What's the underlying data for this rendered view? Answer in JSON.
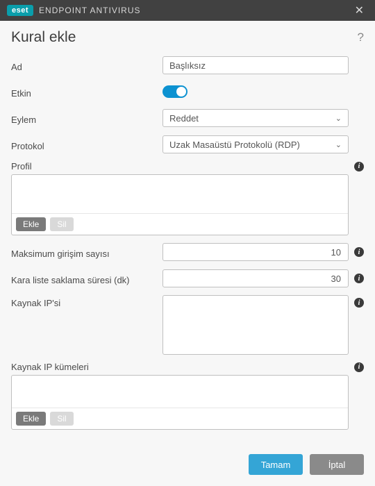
{
  "titlebar": {
    "brand_badge": "eset",
    "brand_text": "ENDPOINT ANTIVIRUS",
    "close_glyph": "✕"
  },
  "page": {
    "title": "Kural ekle",
    "help_glyph": "?"
  },
  "labels": {
    "name": "Ad",
    "enabled": "Etkin",
    "action": "Eylem",
    "protocol": "Protokol",
    "profile": "Profil",
    "max_attempts": "Maksimum girişim sayısı",
    "blacklist_retention": "Kara liste saklama süresi (dk)",
    "source_ip": "Kaynak IP'si",
    "source_ip_sets": "Kaynak IP kümeleri"
  },
  "values": {
    "name": "Başlıksız",
    "action": "Reddet",
    "protocol": "Uzak Masaüstü Protokolü (RDP)",
    "max_attempts": "10",
    "blacklist_retention": "30"
  },
  "buttons": {
    "add": "Ekle",
    "remove": "Sil",
    "ok": "Tamam",
    "cancel": "İptal"
  },
  "icons": {
    "info": "i"
  }
}
